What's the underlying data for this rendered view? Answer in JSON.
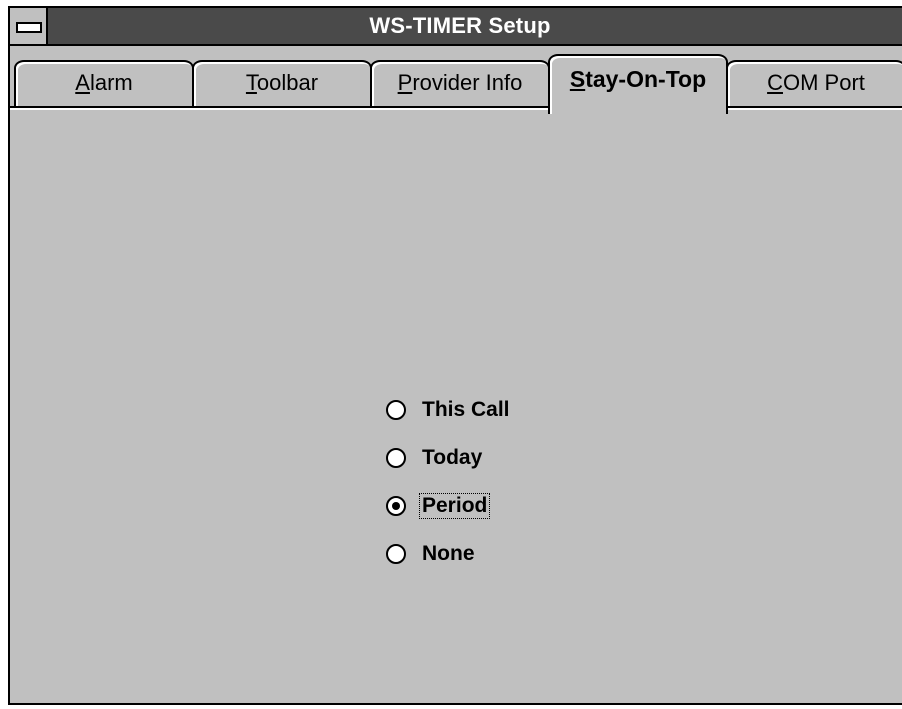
{
  "window": {
    "title": "WS-TIMER Setup"
  },
  "tabs": [
    {
      "label": "Alarm",
      "mnemonic": "A",
      "rest": "larm",
      "selected": false
    },
    {
      "label": "Toolbar",
      "mnemonic": "T",
      "rest": "oolbar",
      "selected": false
    },
    {
      "label": "Provider Info",
      "mnemonic": "P",
      "rest": "rovider Info",
      "selected": false
    },
    {
      "label": "Stay-On-Top",
      "mnemonic": "S",
      "rest": "tay-On-Top",
      "selected": true
    },
    {
      "label": "COM Port",
      "mnemonic": "C",
      "rest": "OM Port",
      "selected": false
    }
  ],
  "stay_on_top": {
    "options": [
      {
        "label": "This Call",
        "checked": false
      },
      {
        "label": "Today",
        "checked": false
      },
      {
        "label": "Period",
        "checked": true
      },
      {
        "label": "None",
        "checked": false
      }
    ]
  },
  "colors": {
    "face": "#c0c0c0",
    "title_bar": "#4a4a4a",
    "title_text": "#ffffff"
  }
}
